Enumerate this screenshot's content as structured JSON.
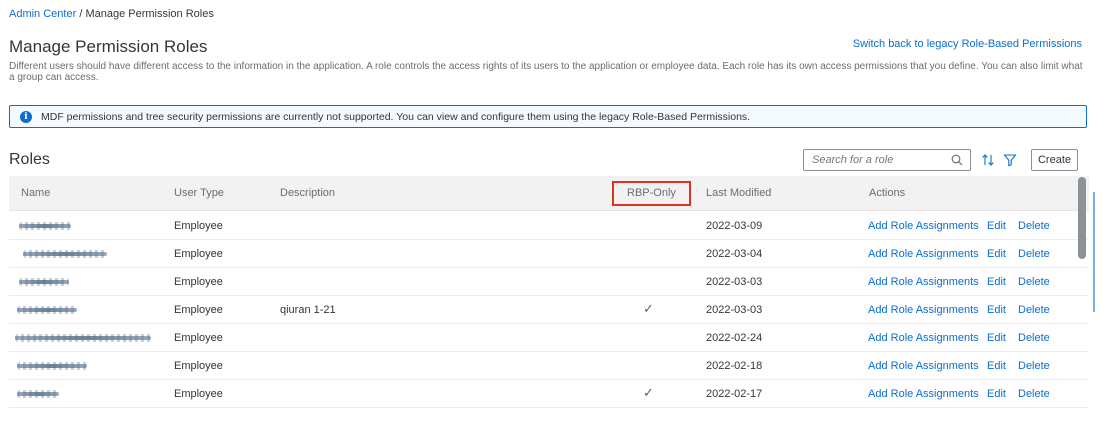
{
  "breadcrumb": {
    "root": "Admin Center",
    "separator": " / ",
    "current": "Manage Permission Roles"
  },
  "header": {
    "title": "Manage Permission Roles",
    "legacy_link": "Switch back to legacy Role-Based Permissions",
    "description": "Different users should have different access to the information in the application. A role controls the access rights of its users to the application or employee data. Each role has its own access permissions that you define. You can also limit what a group can access."
  },
  "info": {
    "message": "MDF permissions and tree security permissions are currently not supported. You can view and configure them using the legacy Role-Based Permissions."
  },
  "roles": {
    "title": "Roles",
    "search_placeholder": "Search for a role",
    "create_label": "Create"
  },
  "table": {
    "headers": {
      "name": "Name",
      "user_type": "User Type",
      "description": "Description",
      "rbp_only": "RBP-Only",
      "last_modified": "Last Modified",
      "actions": "Actions"
    },
    "rows": [
      {
        "user_type": "Employee",
        "description": "",
        "rbp_only": "",
        "last_modified": "2022-03-09"
      },
      {
        "user_type": "Employee",
        "description": "",
        "rbp_only": "",
        "last_modified": "2022-03-04"
      },
      {
        "user_type": "Employee",
        "description": "",
        "rbp_only": "",
        "last_modified": "2022-03-03"
      },
      {
        "user_type": "Employee",
        "description": "qiuran 1-21",
        "rbp_only": "✓",
        "last_modified": "2022-03-03"
      },
      {
        "user_type": "Employee",
        "description": "",
        "rbp_only": "",
        "last_modified": "2022-02-24"
      },
      {
        "user_type": "Employee",
        "description": "",
        "rbp_only": "",
        "last_modified": "2022-02-18"
      },
      {
        "user_type": "Employee",
        "description": "",
        "rbp_only": "✓",
        "last_modified": "2022-02-17"
      }
    ],
    "actions": {
      "assign": "Add Role Assignments",
      "edit": "Edit",
      "delete": "Delete"
    }
  },
  "icons": {
    "info": "info-icon",
    "search": "search-icon",
    "sort": "sort-icon",
    "filter": "filter-icon"
  },
  "colors": {
    "link": "#0a6ed1",
    "highlight": "#e0301e",
    "header_bg": "#f2f2f2"
  }
}
